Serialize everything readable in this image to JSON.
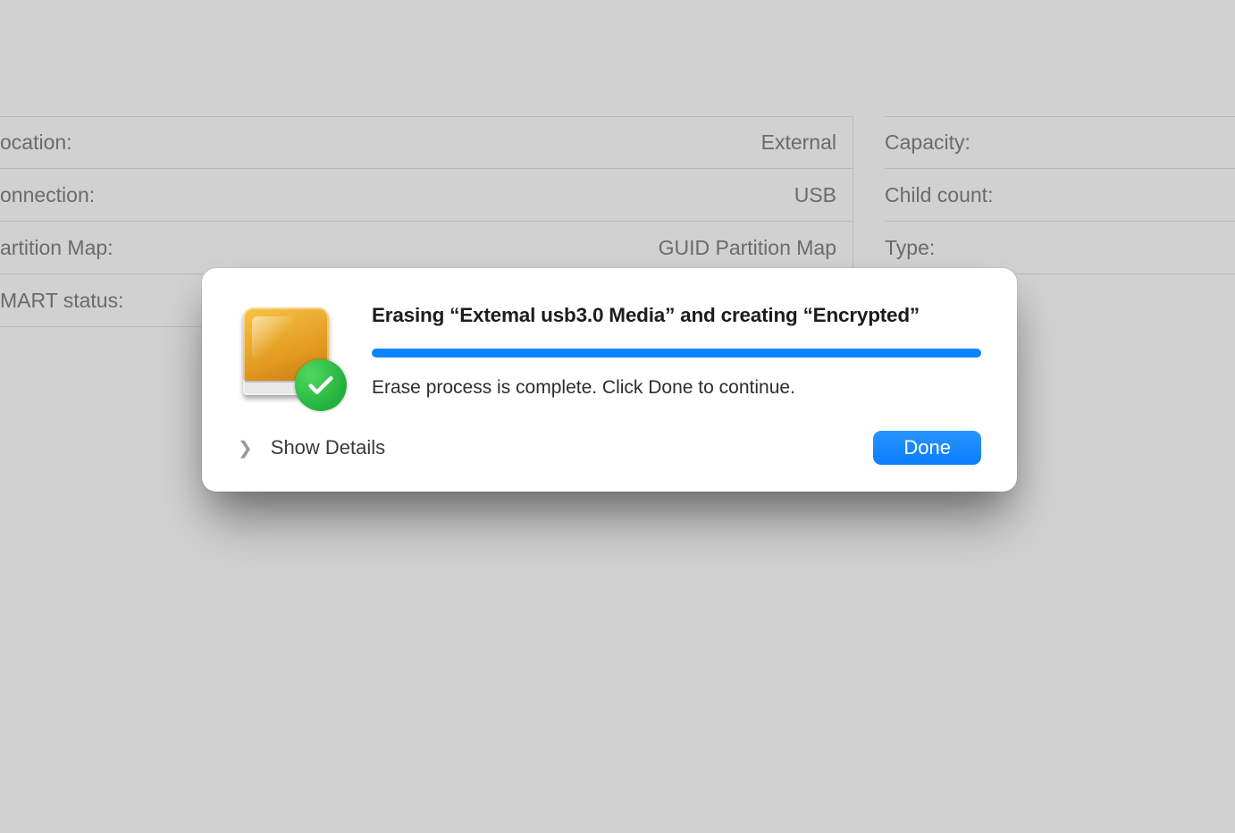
{
  "background": {
    "left_rows": [
      {
        "label": "ocation:",
        "value": "External"
      },
      {
        "label": "onnection:",
        "value": "USB"
      },
      {
        "label": "artition Map:",
        "value": "GUID Partition Map"
      },
      {
        "label": "MART status:",
        "value": ""
      }
    ],
    "right_rows": [
      {
        "label": "Capacity:"
      },
      {
        "label": "Child count:"
      },
      {
        "label": "Type:"
      }
    ]
  },
  "dialog": {
    "title": "Erasing “Extemal usb3.0 Media” and creating “Encrypted”",
    "status": "Erase process is complete. Click Done to continue.",
    "progress_percent": 100,
    "show_details_label": "Show Details",
    "done_label": "Done"
  }
}
